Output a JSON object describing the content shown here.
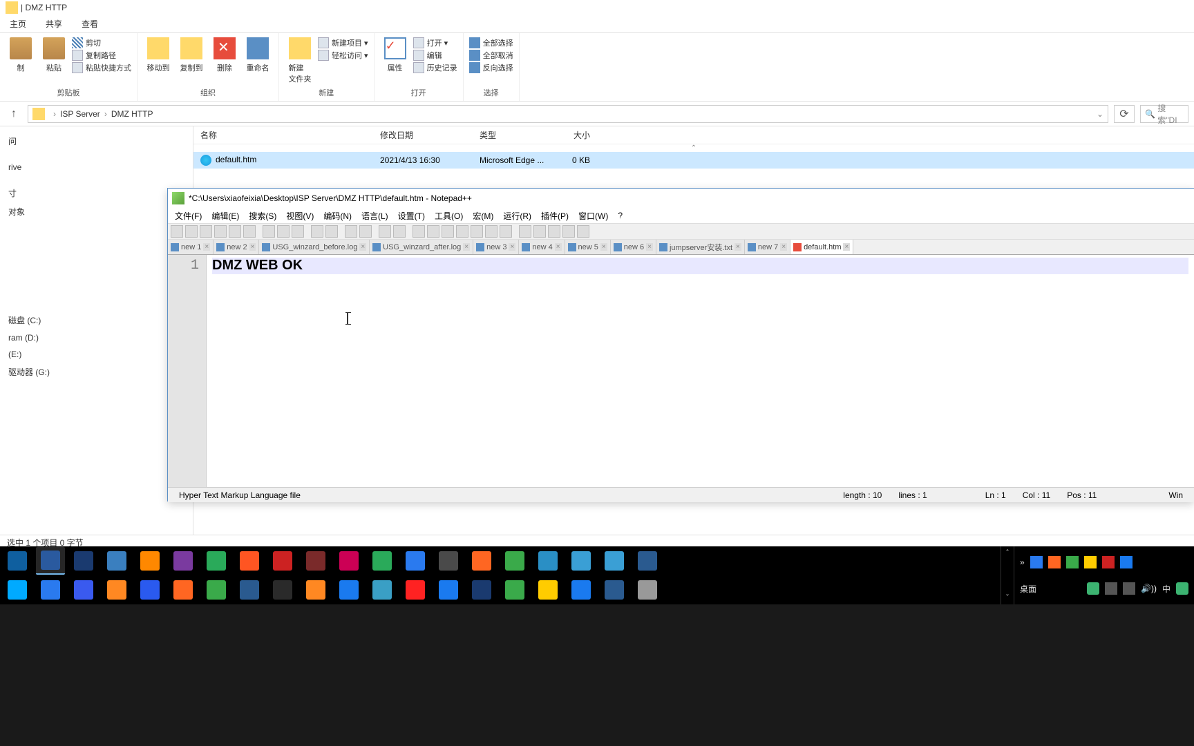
{
  "explorer": {
    "title": "DMZ HTTP",
    "tabs": [
      "主页",
      "共享",
      "查看"
    ],
    "ribbon": {
      "clipboard": {
        "paste": "粘贴",
        "cut": "剪切",
        "copyPath": "复制路径",
        "pasteShortcut": "粘贴快捷方式",
        "label": "剪贴板"
      },
      "organize": {
        "moveTo": "移动到",
        "copyTo": "复制到",
        "delete": "删除",
        "rename": "重命名",
        "label": "组织"
      },
      "new": {
        "newFolder": "新建\n文件夹",
        "newItem": "新建项目 ▾",
        "easyAccess": "轻松访问 ▾",
        "label": "新建"
      },
      "open": {
        "properties": "属性",
        "open": "打开 ▾",
        "edit": "编辑",
        "history": "历史记录",
        "label": "打开"
      },
      "select": {
        "all": "全部选择",
        "none": "全部取消",
        "invert": "反向选择",
        "label": "选择"
      }
    },
    "breadcrumb": [
      "ISP Server",
      "DMZ HTTP"
    ],
    "searchPlaceholder": "搜索\"DI",
    "columns": {
      "name": "名称",
      "date": "修改日期",
      "type": "类型",
      "size": "大小"
    },
    "files": [
      {
        "name": "default.htm",
        "date": "2021/4/13 16:30",
        "type": "Microsoft Edge ...",
        "size": "0 KB"
      }
    ],
    "sidebar": [
      "问",
      "rive",
      "寸",
      "对象",
      "",
      "磁盘 (C:)",
      "ram (D:)",
      "(E:)",
      "驱动器 (G:)"
    ],
    "status": "选中 1 个项目  0 字节"
  },
  "npp": {
    "title": "*C:\\Users\\xiaofeixia\\Desktop\\ISP Server\\DMZ HTTP\\default.htm - Notepad++",
    "menu": [
      "文件(F)",
      "编辑(E)",
      "搜索(S)",
      "视图(V)",
      "编码(N)",
      "语言(L)",
      "设置(T)",
      "工具(O)",
      "宏(M)",
      "运行(R)",
      "插件(P)",
      "窗口(W)",
      "?"
    ],
    "tabs": [
      {
        "label": "new 1",
        "modified": false
      },
      {
        "label": "new 2",
        "modified": false
      },
      {
        "label": "USG_winzard_before.log",
        "modified": false
      },
      {
        "label": "USG_winzard_after.log",
        "modified": false
      },
      {
        "label": "new 3",
        "modified": false
      },
      {
        "label": "new 4",
        "modified": false
      },
      {
        "label": "new 5",
        "modified": false
      },
      {
        "label": "new 6",
        "modified": false
      },
      {
        "label": "jumpserver安装.txt",
        "modified": false
      },
      {
        "label": "new 7",
        "modified": false
      },
      {
        "label": "default.htm",
        "modified": true,
        "active": true
      }
    ],
    "lineNumber": "1",
    "content": "DMZ WEB OK",
    "status": {
      "type": "Hyper Text Markup Language file",
      "length": "length : 10",
      "lines": "lines : 1",
      "ln": "Ln : 1",
      "col": "Col : 11",
      "pos": "Pos : 11",
      "os": "Win"
    }
  },
  "systray": {
    "desktop": "桌面",
    "ime": "中"
  },
  "taskIcons": [
    [
      "#0f5f9f",
      "#2a5a9f",
      "#1a3a6f",
      "#3a7fbf",
      "#ff8800",
      "#7a3a9f",
      "#2aaa5a",
      "#ff5522",
      "#cc2222",
      "#7a2a2a",
      "#cc0055",
      "#2aaa5a",
      "#2a7aef",
      "#4a4a4a",
      "#ff6622",
      "#3aaa4a",
      "#2a8fc5",
      "#3a9fd5",
      "#3a9fd5",
      "#2a5a8f"
    ],
    [
      "#00aaff",
      "#2a7aef",
      "#3a5aef",
      "#ff8822",
      "#2a5aef",
      "#ff6622",
      "#3aaa4a",
      "#2a5a8f",
      "#2a2a2a",
      "#ff8822",
      "#1a7aef",
      "#3a9fc5",
      "#ff2222",
      "#1a7aef",
      "#1a3a6f",
      "#3aaa4a",
      "#ffcc00",
      "#1a7aef",
      "#2a5a8f",
      "#999999"
    ]
  ]
}
